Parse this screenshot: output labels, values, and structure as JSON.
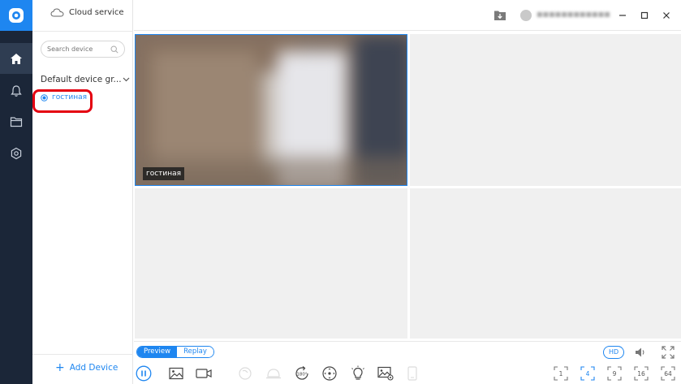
{
  "sidebar": {
    "nav": [
      {
        "name": "home-icon",
        "active": true
      },
      {
        "name": "bell-icon",
        "active": false
      },
      {
        "name": "folder-icon",
        "active": false
      },
      {
        "name": "settings-icon",
        "active": false
      }
    ]
  },
  "panel": {
    "cloud_label": "Cloud service",
    "search_placeholder": "Search device",
    "group_label": "Default device gr...",
    "device_name": "гостиная",
    "add_device_label": "Add Device"
  },
  "topbar": {
    "username": "■■■■■■■■■■■■"
  },
  "video": {
    "camera_label": "гостиная"
  },
  "toolbar": {
    "preview_label": "Preview",
    "replay_label": "Replay",
    "hd_label": "HD",
    "split_labels": [
      "1",
      "4",
      "9",
      "16",
      "64"
    ],
    "active_split": "4"
  },
  "colors": {
    "accent": "#1e86f0",
    "rail_bg": "#1b2638",
    "highlight": "#e40010"
  }
}
